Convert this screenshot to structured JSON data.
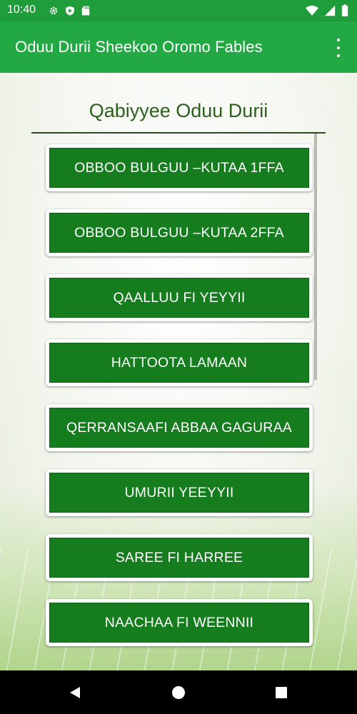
{
  "status_bar": {
    "time": "10:40",
    "left_icons": [
      "gear-icon",
      "play-protect-icon",
      "sd-card-icon"
    ],
    "right_icons": [
      "wifi-icon",
      "signal-icon",
      "battery-icon"
    ],
    "color": "#1f9d3a"
  },
  "app_bar": {
    "title": "Oduu Durii Sheekoo Oromo Fables",
    "color": "#23a943",
    "overflow_icon": "more-vert-icon"
  },
  "content": {
    "section_title": "Qabiyyee Oduu Durii",
    "stories": [
      {
        "label": "OBBOO BULGUU –KUTAA 1FFA"
      },
      {
        "label": "OBBOO BULGUU –KUTAA 2FFA"
      },
      {
        "label": "QAALLUU FI YEYYII"
      },
      {
        "label": "HATTOOTA LAMAAN"
      },
      {
        "label": "QERRANSAAFI ABBAA GAGURAA"
      },
      {
        "label": "UMURII YEEYYII"
      },
      {
        "label": "SAREE FI HARREE"
      },
      {
        "label": "NAACHAA FI WEENNII"
      }
    ],
    "button_color": "#167d1f"
  },
  "nav_bar": {
    "icons": [
      "back-icon",
      "home-icon",
      "recents-icon"
    ]
  }
}
